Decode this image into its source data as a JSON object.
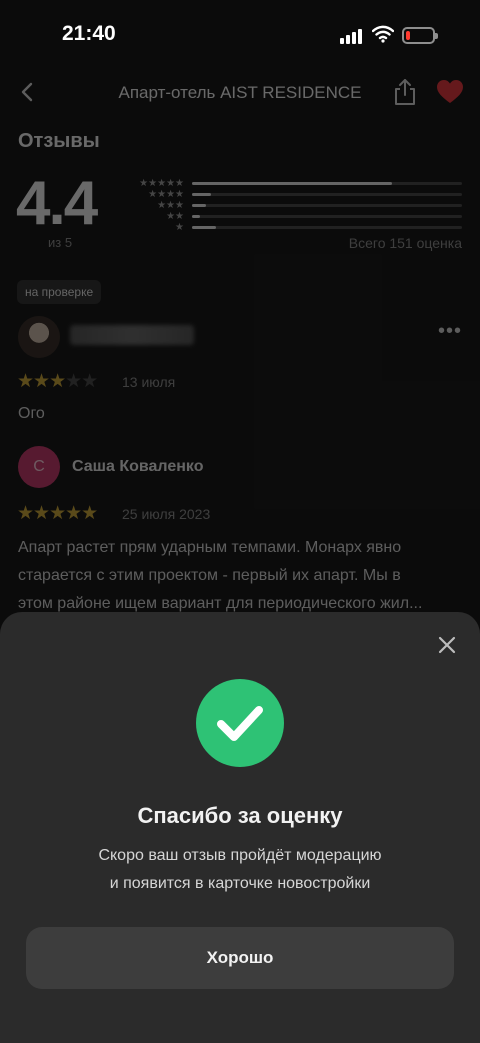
{
  "status_bar": {
    "time": "21:40"
  },
  "header": {
    "title": "Апарт-отель AIST RESIDENCE"
  },
  "reviews": {
    "section_title": "Отзывы",
    "rating": "4.4",
    "rating_of": "из 5",
    "total": "Всего 151 оценка",
    "distribution": [
      {
        "stars": "★★★★★",
        "share": 0.74
      },
      {
        "stars": "★★★★",
        "share": 0.07
      },
      {
        "stars": "★★★",
        "share": 0.05
      },
      {
        "stars": "★★",
        "share": 0.03
      },
      {
        "stars": "★",
        "share": 0.09
      }
    ],
    "items": [
      {
        "badge": "на проверке",
        "stars": "★★★",
        "stars_off": "★★",
        "date": "13 июля",
        "text": "Ого"
      },
      {
        "avatar_letter": "С",
        "author": "Саша Коваленко",
        "stars": "★★★★★",
        "stars_off": "",
        "date": "25 июля 2023",
        "text_lines": [
          "Апарт растет прям ударным темпами. Монарх явно",
          "старается с этим проектом - первый их апарт. Мы в",
          "этом районе ищем вариант для периодического жил..."
        ]
      }
    ]
  },
  "sheet": {
    "title": "Спасибо за оценку",
    "text_line1": "Скоро ваш отзыв пройдёт модерацию",
    "text_line2": "и появится в карточке новостройки",
    "ok_label": "Хорошо"
  },
  "colors": {
    "success": "#2ec275",
    "star_on": "#c8a43a",
    "heart": "#e0393e",
    "avatar": "#c03a6a"
  }
}
